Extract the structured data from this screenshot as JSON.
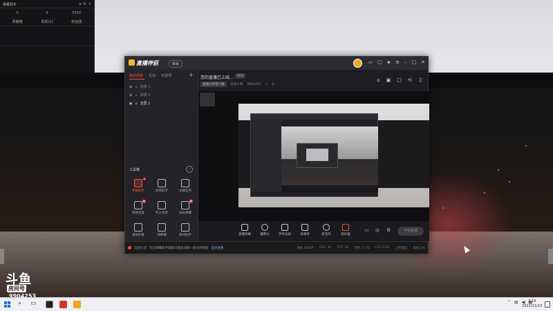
{
  "stat_panel": {
    "title": "弹幕助手",
    "stats": [
      "0",
      "0",
      "5542"
    ],
    "labels": [
      "贡献榜",
      "贵宾(1)",
      "粉丝团"
    ]
  },
  "app": {
    "name": "直播伴侣",
    "version_label": "新版",
    "sidebar_tabs": [
      "我的场景",
      "互动",
      "可选项"
    ],
    "scenes": [
      "场景 1",
      "场景 2",
      "全屏 1"
    ],
    "toolbox_title": "工具箱",
    "tools": [
      {
        "label": "弹幕助手",
        "icon": "danmaku-icon",
        "hot": true,
        "badge": "1"
      },
      {
        "label": "房管助手",
        "icon": "admin-icon",
        "hot": false,
        "badge": ""
      },
      {
        "label": "主播任务",
        "icon": "task-icon",
        "hot": false,
        "badge": ""
      },
      {
        "label": "视频连麦",
        "icon": "video-link-icon",
        "hot": false,
        "badge": "新"
      },
      {
        "label": "导入场景",
        "icon": "import-icon",
        "hot": false,
        "badge": ""
      },
      {
        "label": "录屏弹幕",
        "icon": "record-icon",
        "hot": false,
        "badge": "新"
      },
      {
        "label": "虚拟形象",
        "icon": "avatar-icon",
        "hot": false,
        "badge": ""
      },
      {
        "label": "弹幕播",
        "icon": "broadcast-icon",
        "hot": false,
        "badge": ""
      },
      {
        "label": "歌词助手",
        "icon": "lyrics-icon",
        "hot": false,
        "badge": ""
      }
    ],
    "live_title": "您的直播已上线...",
    "edit_label": "修改",
    "category": "直播分享客户端",
    "online_label": "在线人数",
    "room_id": "9904253",
    "likes": "0",
    "controls": [
      "直播屏幕",
      "摄像头",
      "手机投屏",
      "多媒体",
      "麦克风",
      "扬声器"
    ],
    "go_live_label": "开始直播",
    "status_left": [
      "马房引流",
      "开启弹幕助手辅助可能会消耗一部分的性能",
      "前往查看"
    ],
    "status_right": [
      "清晰 1080P",
      "CPU: 40",
      "FPS: 30",
      "内存: 1.7G",
      "CPU 12%",
      "上传速度",
      "丢帧 0%"
    ]
  },
  "watermark": {
    "brand": "斗鱼",
    "room_label": "房间号",
    "room_number": "9904253"
  },
  "taskbar": {
    "time": "2:14",
    "date": "2021/11/13"
  }
}
